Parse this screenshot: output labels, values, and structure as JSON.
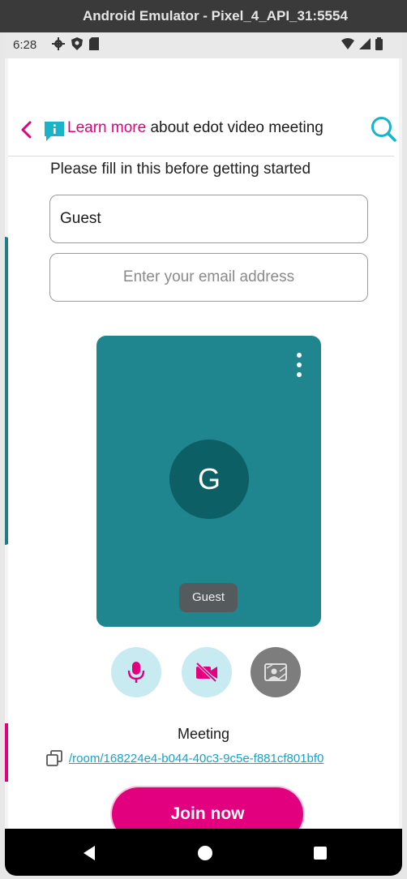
{
  "window": {
    "title": "Android Emulator - Pixel_4_API_31:5554"
  },
  "status_bar": {
    "time": "6:28"
  },
  "header": {
    "link_text": "Learn more",
    "rest_text": " about edot video meeting"
  },
  "form": {
    "intro": "Please fill in this before getting started",
    "name_value": "Guest",
    "email_placeholder": "Enter your email address"
  },
  "preview": {
    "avatar_initial": "G",
    "participant_name": "Guest"
  },
  "controls": {
    "mic": "microphone-icon",
    "camera": "camera-off-icon",
    "background": "background-blur-icon"
  },
  "meeting": {
    "label": "Meeting",
    "room_link": "/room/168224e4-b044-40c3-9c5e-f881cf801bf0"
  },
  "actions": {
    "join_label": "Join now"
  },
  "colors": {
    "brand_pink": "#e3007f",
    "teal": "#1f858f",
    "avatar_teal": "#0d5f66",
    "search_cyan": "#19b4c8",
    "control_light": "#c7ebf1",
    "control_gray": "#7d7d7d"
  }
}
